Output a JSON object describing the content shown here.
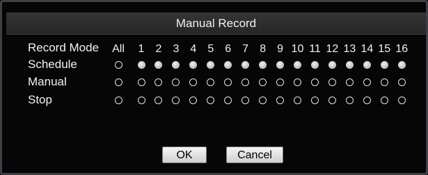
{
  "dialog": {
    "title": "Manual Record",
    "header_label": "Record Mode",
    "all_label": "All",
    "channels": [
      "1",
      "2",
      "3",
      "4",
      "5",
      "6",
      "7",
      "8",
      "9",
      "10",
      "11",
      "12",
      "13",
      "14",
      "15",
      "16"
    ],
    "rows": [
      {
        "label": "Schedule",
        "all_selected": false,
        "channels_selected": [
          true,
          true,
          true,
          true,
          true,
          true,
          true,
          true,
          true,
          true,
          true,
          true,
          true,
          true,
          true,
          true
        ]
      },
      {
        "label": "Manual",
        "all_selected": false,
        "channels_selected": [
          false,
          false,
          false,
          false,
          false,
          false,
          false,
          false,
          false,
          false,
          false,
          false,
          false,
          false,
          false,
          false
        ]
      },
      {
        "label": "Stop",
        "all_selected": false,
        "channels_selected": [
          false,
          false,
          false,
          false,
          false,
          false,
          false,
          false,
          false,
          false,
          false,
          false,
          false,
          false,
          false,
          false
        ]
      }
    ]
  },
  "buttons": {
    "ok_label": "OK",
    "cancel_label": "Cancel"
  }
}
